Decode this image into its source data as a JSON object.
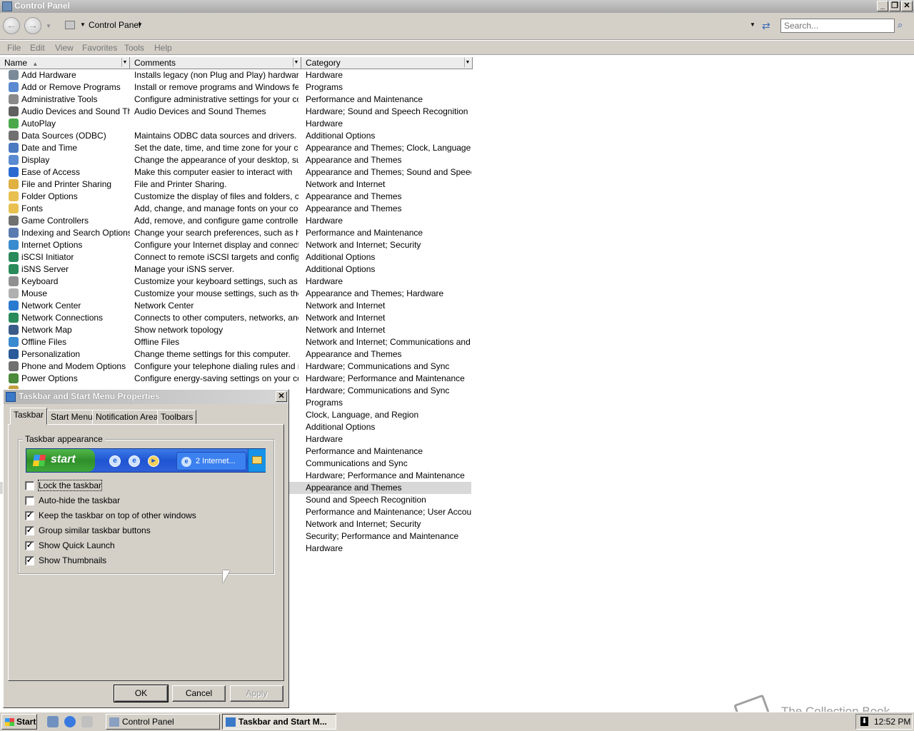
{
  "window": {
    "title": "Control Panel",
    "minimize": "_",
    "restore": "❐",
    "close": "✕"
  },
  "address": {
    "back": "←",
    "forward": "→",
    "location": "Control Panel",
    "search_placeholder": "Search..."
  },
  "menu": [
    "File",
    "Edit",
    "View",
    "Favorites",
    "Tools",
    "Help"
  ],
  "columns": {
    "name": "Name",
    "comments": "Comments",
    "category": "Category"
  },
  "items": [
    {
      "name": "Add Hardware",
      "comment": "Installs legacy (non Plug and Play) hardware.",
      "category": "Hardware",
      "color": "#7a8a9a"
    },
    {
      "name": "Add or Remove Programs",
      "comment": "Install or remove programs and Windows featu...",
      "category": "Programs",
      "color": "#5a8ad0"
    },
    {
      "name": "Administrative Tools",
      "comment": "Configure administrative settings for your comp...",
      "category": "Performance and Maintenance",
      "color": "#8a8a8a"
    },
    {
      "name": "Audio Devices and Sound Th...",
      "comment": "Audio Devices and Sound Themes",
      "category": "Hardware; Sound and Speech Recognition",
      "color": "#606060"
    },
    {
      "name": "AutoPlay",
      "comment": "",
      "category": "Hardware",
      "color": "#4aa84a"
    },
    {
      "name": "Data Sources (ODBC)",
      "comment": "Maintains ODBC data sources and drivers.",
      "category": "Additional Options",
      "color": "#707070"
    },
    {
      "name": "Date and Time",
      "comment": "Set the date, time, and time zone for your com...",
      "category": "Appearance and Themes; Clock, Language, a...",
      "color": "#4a7ac0"
    },
    {
      "name": "Display",
      "comment": "Change the appearance of your desktop, suc...",
      "category": "Appearance and Themes",
      "color": "#5a8ad0"
    },
    {
      "name": "Ease of Access",
      "comment": "Make this computer easier to interact with",
      "category": "Appearance and Themes; Sound and Speech...",
      "color": "#2a6ad0"
    },
    {
      "name": "File and Printer Sharing",
      "comment": "File and Printer Sharing.",
      "category": "Network and Internet",
      "color": "#e0b040"
    },
    {
      "name": "Folder Options",
      "comment": "Customize the display of files and folders, chan...",
      "category": "Appearance and Themes",
      "color": "#e8c050"
    },
    {
      "name": "Fonts",
      "comment": "Add, change, and manage fonts on your comp...",
      "category": "Appearance and Themes",
      "color": "#e8c050"
    },
    {
      "name": "Game Controllers",
      "comment": "Add, remove, and configure game controller h...",
      "category": "Hardware",
      "color": "#707070"
    },
    {
      "name": "Indexing and Search Options",
      "comment": "Change your search preferences, such as ho...",
      "category": "Performance and Maintenance",
      "color": "#5a7ab0"
    },
    {
      "name": "Internet Options",
      "comment": "Configure your Internet display and connection...",
      "category": "Network and Internet; Security",
      "color": "#3a8ad0"
    },
    {
      "name": "iSCSI Initiator",
      "comment": "Connect to remote iSCSI targets and configure...",
      "category": "Additional Options",
      "color": "#2a8a5a"
    },
    {
      "name": "iSNS Server",
      "comment": "Manage your iSNS server.",
      "category": "Additional Options",
      "color": "#2a8a5a"
    },
    {
      "name": "Keyboard",
      "comment": "Customize your keyboard settings, such as the...",
      "category": "Hardware",
      "color": "#909090"
    },
    {
      "name": "Mouse",
      "comment": "Customize your mouse settings, such as the b...",
      "category": "Appearance and Themes; Hardware",
      "color": "#b0b0b0"
    },
    {
      "name": "Network Center",
      "comment": "Network Center",
      "category": "Network and Internet",
      "color": "#2a7ad0"
    },
    {
      "name": "Network Connections",
      "comment": "Connects to other computers, networks, and t...",
      "category": "Network and Internet",
      "color": "#2a8a5a"
    },
    {
      "name": "Network Map",
      "comment": "Show network topology",
      "category": "Network and Internet",
      "color": "#3a5a8a"
    },
    {
      "name": "Offline Files",
      "comment": "Offline Files",
      "category": "Network and Internet; Communications and Sy...",
      "color": "#3a8ad0"
    },
    {
      "name": "Personalization",
      "comment": "Change theme settings for this computer.",
      "category": "Appearance and Themes",
      "color": "#2a5a9a"
    },
    {
      "name": "Phone and Modem Options",
      "comment": "Configure your telephone dialing rules and mo...",
      "category": "Hardware; Communications and Sync",
      "color": "#707070"
    },
    {
      "name": "Power Options",
      "comment": "Configure energy-saving settings on your com...",
      "category": "Hardware; Performance and Maintenance",
      "color": "#4a8a3a"
    },
    {
      "name": "",
      "comment": "",
      "category": "Hardware; Communications and Sync",
      "color": "#c0a040"
    },
    {
      "name": "",
      "comment": "",
      "category": "Programs",
      "color": ""
    },
    {
      "name": "",
      "comment": "",
      "category": "Clock, Language, and Region",
      "color": ""
    },
    {
      "name": "",
      "comment": "",
      "category": "Additional Options",
      "color": ""
    },
    {
      "name": "",
      "comment": "",
      "category": "Hardware",
      "color": ""
    },
    {
      "name": "",
      "comment": ".",
      "category": "Performance and Maintenance",
      "color": ""
    },
    {
      "name": "",
      "comment": "",
      "category": "Communications and Sync",
      "color": ""
    },
    {
      "name": "",
      "comment": ".",
      "category": "Hardware; Performance and Maintenance",
      "color": ""
    },
    {
      "name": "",
      "comment": "..",
      "category": "Appearance and Themes",
      "color": ""
    },
    {
      "name": "",
      "comment": "..",
      "category": "Sound and Speech Recognition",
      "color": ""
    },
    {
      "name": "",
      "comment": "..",
      "category": "Performance and Maintenance; User Account...",
      "color": ""
    },
    {
      "name": "",
      "comment": "..",
      "category": "Network and Internet; Security",
      "color": ""
    },
    {
      "name": "",
      "comment": "..",
      "category": "Security; Performance and Maintenance",
      "color": ""
    },
    {
      "name": "",
      "comment": "..",
      "category": "Hardware",
      "color": ""
    }
  ],
  "dialog": {
    "title": "Taskbar and Start Menu Properties",
    "close": "✕",
    "tabs": [
      "Taskbar",
      "Start Menu",
      "Notification Area",
      "Toolbars"
    ],
    "group_label": "Taskbar appearance",
    "preview_start": "start",
    "preview_task": "2 Internet...",
    "options": [
      {
        "label": "Lock the taskbar",
        "checked": false
      },
      {
        "label": "Auto-hide the taskbar",
        "checked": false
      },
      {
        "label": "Keep the taskbar on top of other windows",
        "checked": true
      },
      {
        "label": "Group similar taskbar buttons",
        "checked": true
      },
      {
        "label": "Show Quick Launch",
        "checked": true
      },
      {
        "label": "Show Thumbnails",
        "checked": true
      }
    ],
    "ok": "OK",
    "cancel": "Cancel",
    "apply": "Apply"
  },
  "taskbar": {
    "start": "Start",
    "items": [
      "Control Panel",
      "Taskbar and Start M..."
    ],
    "clock": "12:52 PM",
    "watermark": "The Collection Book"
  }
}
